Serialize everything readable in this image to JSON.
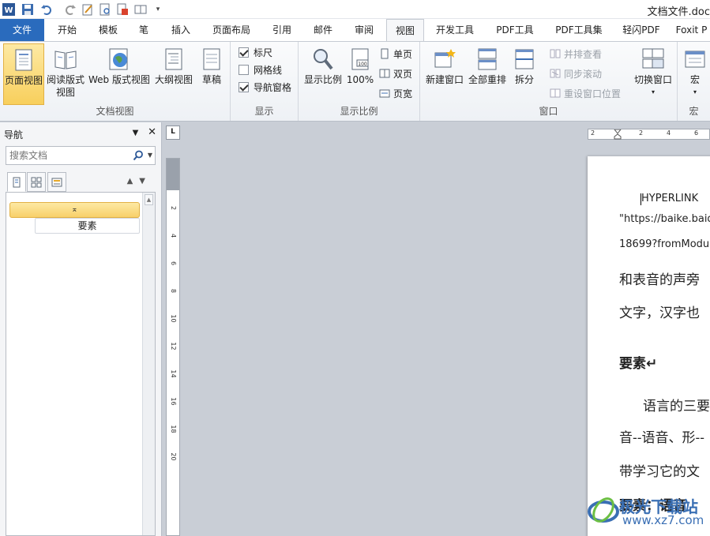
{
  "titlebar": {
    "doc_title": "文档文件.doc"
  },
  "tabs": [
    {
      "label": "文件"
    },
    {
      "label": "开始"
    },
    {
      "label": "模板"
    },
    {
      "label": "笔"
    },
    {
      "label": "插入"
    },
    {
      "label": "页面布局"
    },
    {
      "label": "引用"
    },
    {
      "label": "邮件"
    },
    {
      "label": "审阅"
    },
    {
      "label": "视图"
    },
    {
      "label": "开发工具"
    },
    {
      "label": "PDF工具"
    },
    {
      "label": "PDF工具集"
    },
    {
      "label": "轻闪PDF"
    },
    {
      "label": "Foxit P"
    }
  ],
  "ribbon": {
    "doc_views": {
      "label": "文档视图",
      "print_layout": "页面视图",
      "reading_line1": "阅读版式",
      "reading_line2": "视图",
      "web_layout": "Web 版式视图",
      "outline": "大纲视图",
      "draft": "草稿"
    },
    "show": {
      "label": "显示",
      "ruler": "标尺",
      "ruler_checked": true,
      "gridlines": "网格线",
      "gridlines_checked": false,
      "nav_pane": "导航窗格",
      "nav_pane_checked": true
    },
    "zoom": {
      "label": "显示比例",
      "zoom": "显示比例",
      "hundred": "100%",
      "one_page": "单页",
      "two_pages": "双页",
      "page_width": "页宽"
    },
    "window": {
      "label": "窗口",
      "new_window": "新建窗口",
      "arrange_all": "全部重排",
      "split": "拆分",
      "side_by_side": "并排查看",
      "sync_scroll": "同步滚动",
      "reset_pos": "重设窗口位置",
      "switch": "切换窗口"
    },
    "macros": {
      "label": "宏",
      "macros": "宏"
    }
  },
  "nav": {
    "title": "导航",
    "search_placeholder": "搜索文档",
    "headings": [
      {
        "label": "要素"
      }
    ]
  },
  "ruler": {
    "corner": "L",
    "h_ticks": [
      "2",
      "2",
      "4",
      "6"
    ],
    "v_ticks": [
      "2",
      "4",
      "6",
      "8",
      "10",
      "12",
      "14",
      "16",
      "18",
      "20"
    ]
  },
  "document": {
    "lines": [
      "HYPERLINK",
      "\"https://baike.baid",
      "18699?fromModu",
      "和表音的声旁",
      "文字，汉字也",
      "要素↵",
      "语言的三要",
      "音--语音、形--",
      "带学习它的文",
      "要素：语音"
    ]
  },
  "watermark": {
    "name": "极光下载站",
    "url": "www.xz7.com"
  },
  "colors": {
    "file_tab": "#2a6bbd",
    "selected": "#f8cf5c"
  }
}
